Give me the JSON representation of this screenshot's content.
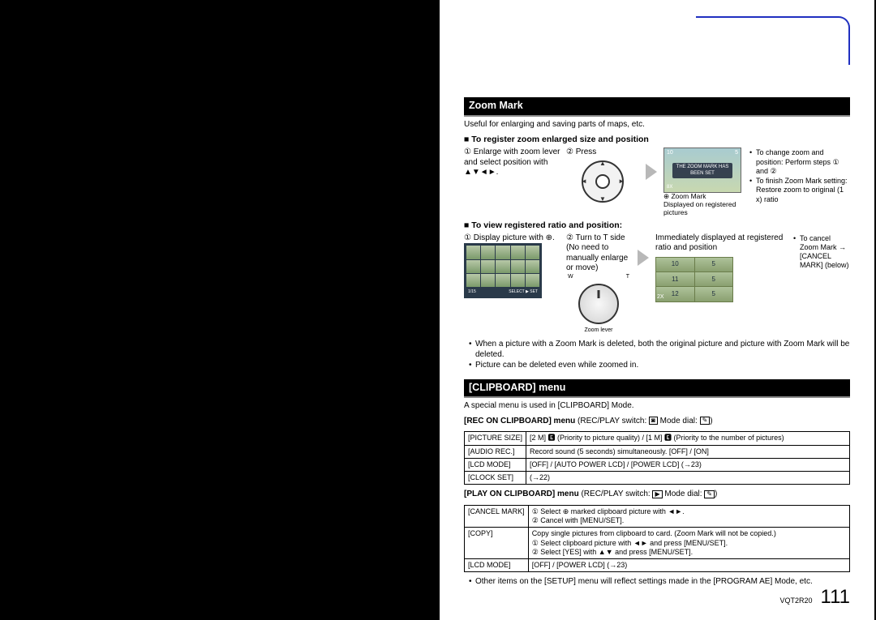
{
  "section1": {
    "title": "Zoom Mark",
    "intro": "Useful for enlarging and saving parts of maps, etc.",
    "sub1": "■ To register zoom enlarged size and position",
    "step1a": "Enlarge with zoom lever and select position with ▲▼◄►.",
    "step1a_num": "①",
    "step1b_num": "②",
    "step1b": "Press",
    "thumb_label": "THE ZOOM MARK HAS BEEN SET",
    "thumb_tl": "10",
    "thumb_tr": "5",
    "thumb_bl": "8X",
    "cap1a": "⊕ Zoom Mark",
    "cap1b": "Displayed on registered pictures",
    "tips1_a": "To change zoom and position: Perform steps ① and ②",
    "tips1_b": "To finish Zoom Mark setting: Restore zoom to original (1 x) ratio",
    "sub2": "■ To view registered ratio and position:",
    "step2a_num": "①",
    "step2a": "Display picture with ⊕.",
    "step2b_num": "②",
    "step2b": "Turn to T side (No need to manually enlarge or move)",
    "dial_w": "W",
    "dial_t": "T",
    "dial_cap": "Zoom lever",
    "right_txt": "Immediately displayed at registered ratio and position",
    "grid": [
      "10",
      "5",
      "11",
      "5",
      "12",
      "5"
    ],
    "grid_bl": "2X",
    "tips2": "To cancel Zoom Mark → [CANCEL MARK] (below)",
    "note1": "When a picture with a Zoom Mark is deleted, both the original picture and picture with Zoom Mark will be deleted.",
    "note2": "Picture can be deleted even while zoomed in.",
    "list_bar_l": "1/15",
    "list_bar_r": "SELECT ▶ SET"
  },
  "section2": {
    "title": "[CLIPBOARD] menu",
    "intro": "A special menu is used in [CLIPBOARD] Mode.",
    "rec_head_a": "[REC ON CLIPBOARD] menu",
    "rec_head_b": " (REC/PLAY switch: ",
    "rec_head_c": " Mode dial: ",
    "rec_head_d": ")",
    "rec_rows": [
      {
        "k": "[PICTURE SIZE]",
        "v": "[2 M] 🅴 (Priority to picture quality) / [1 M] 🅴 (Priority to the number of pictures)"
      },
      {
        "k": "[AUDIO REC.]",
        "v": "Record sound (5 seconds) simultaneously. [OFF] / [ON]"
      },
      {
        "k": "[LCD MODE]",
        "v": "[OFF] / [AUTO POWER LCD] / [POWER LCD] (→23)"
      },
      {
        "k": "[CLOCK SET]",
        "v": "(→22)"
      }
    ],
    "play_head_a": "[PLAY ON CLIPBOARD] menu",
    "play_head_b": " (REC/PLAY switch: ",
    "play_head_c": " Mode dial: ",
    "play_head_d": ")",
    "play_rows": [
      {
        "k": "[CANCEL MARK]",
        "v": "① Select ⊕ marked clipboard picture with ◄►.\n② Cancel with [MENU/SET]."
      },
      {
        "k": "[COPY]",
        "v": "Copy single pictures from clipboard to card. (Zoom Mark will not be copied.)\n① Select clipboard picture with ◄► and press [MENU/SET].\n② Select [YES] with ▲▼ and press [MENU/SET]."
      },
      {
        "k": "[LCD MODE]",
        "v": "[OFF] / [POWER LCD] (→23)"
      }
    ],
    "end_note": "Other items on the [SETUP] menu will reflect settings made in the [PROGRAM AE] Mode, etc."
  },
  "footer": {
    "code": "VQT2R20",
    "page": "111"
  },
  "icons": {
    "camera": "◻",
    "play": "▶",
    "clip": "✎"
  }
}
